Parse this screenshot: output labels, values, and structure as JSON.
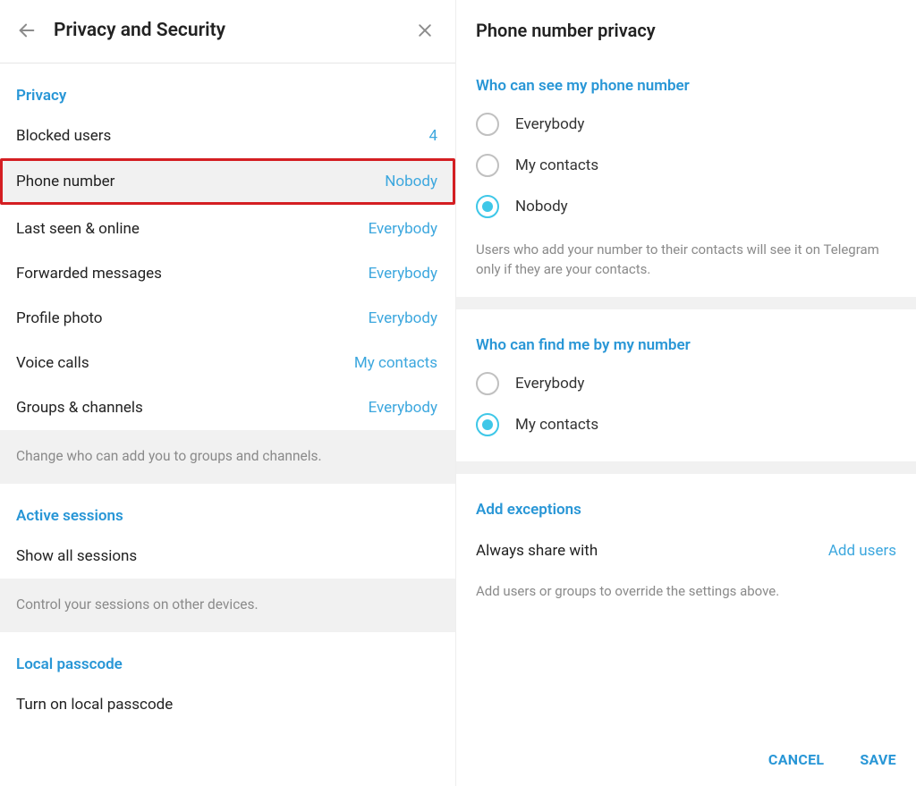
{
  "left": {
    "title": "Privacy and Security",
    "sections": {
      "privacy": {
        "header": "Privacy",
        "rows": [
          {
            "label": "Blocked users",
            "value": "4"
          },
          {
            "label": "Phone number",
            "value": "Nobody",
            "highlighted": true
          },
          {
            "label": "Last seen & online",
            "value": "Everybody"
          },
          {
            "label": "Forwarded messages",
            "value": "Everybody"
          },
          {
            "label": "Profile photo",
            "value": "Everybody"
          },
          {
            "label": "Voice calls",
            "value": "My contacts"
          },
          {
            "label": "Groups & channels",
            "value": "Everybody"
          }
        ],
        "hint": "Change who can add you to groups and channels."
      },
      "sessions": {
        "header": "Active sessions",
        "row_label": "Show all sessions",
        "hint": "Control your sessions on other devices."
      },
      "passcode": {
        "header": "Local passcode",
        "row_label": "Turn on local passcode"
      }
    }
  },
  "right": {
    "title": "Phone number privacy",
    "see_section": {
      "title": "Who can see my phone number",
      "options": [
        {
          "label": "Everybody",
          "selected": false
        },
        {
          "label": "My contacts",
          "selected": false
        },
        {
          "label": "Nobody",
          "selected": true
        }
      ],
      "hint": "Users who add your number to their contacts will see it on Telegram only if they are your contacts."
    },
    "find_section": {
      "title": "Who can find me by my number",
      "options": [
        {
          "label": "Everybody",
          "selected": false
        },
        {
          "label": "My contacts",
          "selected": true
        }
      ]
    },
    "exceptions": {
      "title": "Add exceptions",
      "row_label": "Always share with",
      "row_action": "Add users",
      "hint": "Add users or groups to override the settings above."
    },
    "footer": {
      "cancel": "CANCEL",
      "save": "SAVE"
    }
  }
}
